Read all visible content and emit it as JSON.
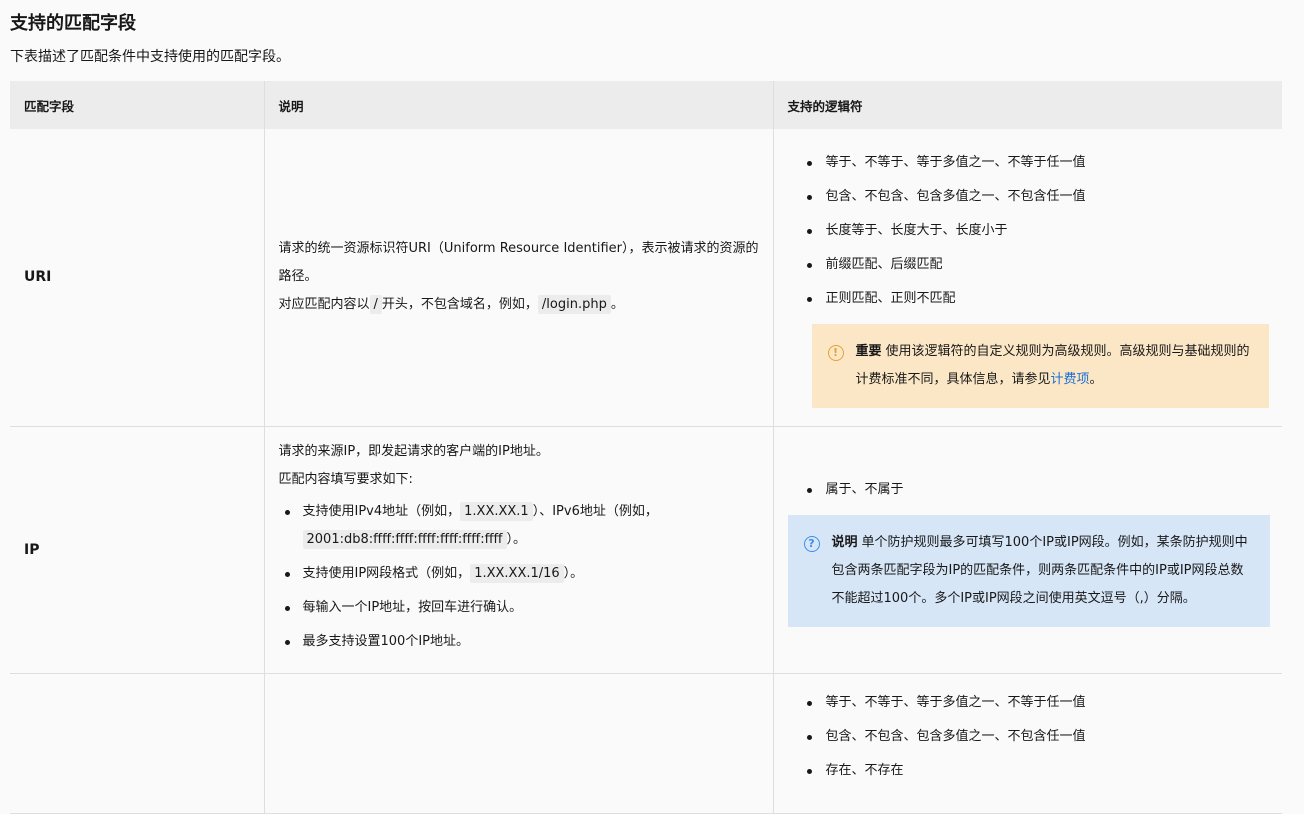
{
  "title": "支持的匹配字段",
  "intro": "下表描述了匹配条件中支持使用的匹配字段。",
  "table": {
    "headers": [
      "匹配字段",
      "说明",
      "支持的逻辑符"
    ],
    "uri": {
      "field": "URI",
      "desc_1": "请求的统一资源标识符URI（Uniform Resource Identifier），表示被请求的资源的路径。",
      "desc_2_pre": "对应匹配内容以",
      "desc_2_code1": "/",
      "desc_2_mid": "开头，不包含域名，例如，",
      "desc_2_code2": "/login.php",
      "desc_2_post": "。",
      "ops": [
        "等于、不等于、等于多值之一、不等于任一值",
        "包含、不包含、包含多值之一、不包含任一值",
        "长度等于、长度大于、长度小于",
        "前缀匹配、后缀匹配",
        "正则匹配、正则不匹配"
      ],
      "note_icon": "warning-icon",
      "note_label": "重要",
      "note_text": "使用该逻辑符的自定义规则为高级规则。高级规则与基础规则的计费标准不同，具体信息，请参见",
      "note_link": "计费项",
      "note_end": "。"
    },
    "ip": {
      "field": "IP",
      "desc_1": "请求的来源IP，即发起请求的客户端的IP地址。",
      "desc_2": "匹配内容填写要求如下:",
      "item1_pre": "支持使用IPv4地址（例如，",
      "item1_code1": "1.XX.XX.1",
      "item1_mid": "）、IPv6地址（例如，",
      "item1_code2": "2001:db8:ffff:ffff:ffff:ffff:ffff:ffff",
      "item1_post": "）。",
      "item2_pre": "支持使用IP网段格式（例如，",
      "item2_code": "1.XX.XX.1/16",
      "item2_post": "）。",
      "item3": "每输入一个IP地址，按回车进行确认。",
      "item4": "最多支持设置100个IP地址。",
      "ops": [
        "属于、不属于"
      ],
      "note_icon": "question-icon",
      "note_label": "说明",
      "note_text": "单个防护规则最多可填写100个IP或IP网段。例如，某条防护规则中包含两条匹配字段为IP的匹配条件，则两条匹配条件中的IP或IP网段总数不能超过100个。多个IP或IP网段之间使用英文逗号（,）分隔。"
    },
    "row3": {
      "ops": [
        "等于、不等于、等于多值之一、不等于任一值",
        "包含、不包含、包含多值之一、不包含任一值",
        "存在、不存在"
      ]
    }
  }
}
